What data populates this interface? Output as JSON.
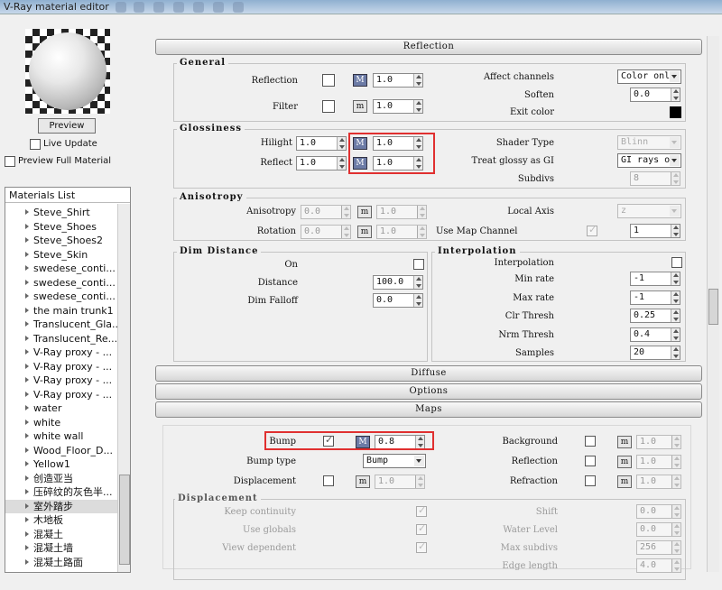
{
  "window": {
    "title": "V-Ray material editor"
  },
  "preview": {
    "button": "Preview",
    "live_update": "Live Update",
    "preview_full": "Preview Full Material"
  },
  "materials": {
    "header": "Materials List",
    "items": [
      "Steve_Shirt",
      "Steve_Shoes",
      "Steve_Shoes2",
      "Steve_Skin",
      "swedese_conti...",
      "swedese_conti...",
      "swedese_conti...",
      "the main trunk1",
      "Translucent_Gla...",
      "Translucent_Re...",
      "V-Ray proxy - ...",
      "V-Ray proxy - ...",
      "V-Ray proxy - ...",
      "V-Ray proxy - ...",
      "water",
      "white",
      "white wall",
      "Wood_Floor_D...",
      "Yellow1",
      "创造亚当",
      "压碎纹的灰色半...",
      "室外踏步",
      "木地板",
      "混凝土",
      "混凝土墙",
      "混凝土路面"
    ],
    "selected_index": 21
  },
  "rollouts": {
    "reflection": "Reflection",
    "diffuse": "Diffuse",
    "options": "Options",
    "maps": "Maps"
  },
  "general": {
    "title": "General",
    "reflection_label": "Reflection",
    "reflection_value": "1.0",
    "reflection_map": "M",
    "filter_label": "Filter",
    "filter_value": "1.0",
    "filter_map": "m",
    "affect_channels_label": "Affect channels",
    "affect_channels_value": "Color only",
    "soften_label": "Soften",
    "soften_value": "0.0",
    "exit_color_label": "Exit color",
    "exit_color": "#000000"
  },
  "glossiness": {
    "title": "Glossiness",
    "hilight_label": "Hilight",
    "hilight_value": "1.0",
    "hilight_map_value": "1.0",
    "hilight_map": "M",
    "reflect_label": "Reflect",
    "reflect_value": "1.0",
    "reflect_map_value": "1.0",
    "reflect_map": "M",
    "shader_type_label": "Shader Type",
    "shader_type_value": "Blinn",
    "treat_glossy_label": "Treat glossy as GI",
    "treat_glossy_value": "GI rays on",
    "subdivs_label": "Subdivs",
    "subdivs_value": "8"
  },
  "anisotropy": {
    "title": "Anisotropy",
    "aniso_label": "Anisotropy",
    "aniso_value": "0.0",
    "aniso_map": "m",
    "aniso_map_value": "1.0",
    "rotation_label": "Rotation",
    "rotation_value": "0.0",
    "rotation_map": "m",
    "rotation_map_value": "1.0",
    "local_axis_label": "Local Axis",
    "local_axis_value": "z",
    "use_map_channel_label": "Use Map Channel",
    "use_map_channel_value": "1"
  },
  "dim_distance": {
    "title": "Dim Distance",
    "on_label": "On",
    "distance_label": "Distance",
    "distance_value": "100.0",
    "falloff_label": "Dim Falloff",
    "falloff_value": "0.0"
  },
  "interpolation": {
    "title": "Interpolation",
    "interp_label": "Interpolation",
    "min_rate_label": "Min rate",
    "min_rate_value": "-1",
    "max_rate_label": "Max rate",
    "max_rate_value": "-1",
    "clr_thresh_label": "Clr Thresh",
    "clr_thresh_value": "0.25",
    "nrm_thresh_label": "Nrm Thresh",
    "nrm_thresh_value": "0.4",
    "samples_label": "Samples",
    "samples_value": "20"
  },
  "maps": {
    "bump_label": "Bump",
    "bump_map": "M",
    "bump_value": "0.8",
    "bump_type_label": "Bump type",
    "bump_type_value": "Bump",
    "displacement_label": "Displacement",
    "displacement_map": "m",
    "displacement_value": "1.0",
    "background_label": "Background",
    "background_map": "m",
    "background_value": "1.0",
    "reflection_label": "Reflection",
    "reflection_map": "m",
    "reflection_value": "1.0",
    "refraction_label": "Refraction",
    "refraction_map": "m",
    "refraction_value": "1.0"
  },
  "displacement": {
    "title": "Displacement",
    "keep_continuity": "Keep continuity",
    "use_globals": "Use globals",
    "view_dependent": "View dependent",
    "shift_label": "Shift",
    "shift_value": "0.0",
    "water_level_label": "Water Level",
    "water_level_value": "0.0",
    "max_subdivs_label": "Max subdivs",
    "max_subdivs_value": "256",
    "edge_length_label": "Edge length",
    "edge_length_value": "4.0"
  },
  "colors": {
    "highlight_box": "#e03030",
    "map_on": "#6c7ba6"
  }
}
